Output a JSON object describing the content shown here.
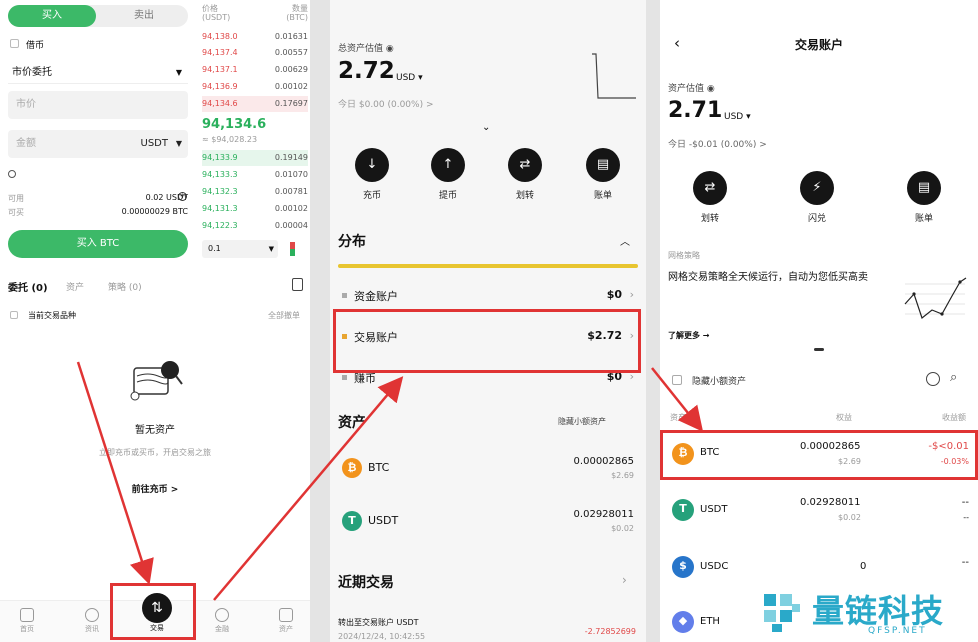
{
  "panel1": {
    "tab_buy": "买入",
    "tab_sell": "卖出",
    "leverage": "借币",
    "order_type": "市价委托",
    "price_placeholder": "市价",
    "amount_placeholder": "金额",
    "amount_unit": "USDT",
    "available_label": "可用",
    "available_value": "0.02 USDT",
    "buyable_label": "可买",
    "buyable_value": "0.00000029 BTC",
    "buy_button": "买入 BTC",
    "ob_header_price": "价格\n(USDT)",
    "ob_header_qty": "数量\n(BTC)",
    "asks": [
      {
        "price": "94,138.0",
        "qty": "0.01631"
      },
      {
        "price": "94,137.4",
        "qty": "0.00557"
      },
      {
        "price": "94,137.1",
        "qty": "0.00629"
      },
      {
        "price": "94,136.9",
        "qty": "0.00102"
      },
      {
        "price": "94,134.6",
        "qty": "0.17697"
      }
    ],
    "last_price": "94,134.6",
    "last_price_sub": "≈ $94,028.23",
    "bids": [
      {
        "price": "94,133.9",
        "qty": "0.19149"
      },
      {
        "price": "94,133.3",
        "qty": "0.01070"
      },
      {
        "price": "94,132.3",
        "qty": "0.00781"
      },
      {
        "price": "94,131.3",
        "qty": "0.00102"
      },
      {
        "price": "94,122.3",
        "qty": "0.00004"
      }
    ],
    "depth_value": "0.1",
    "orders_tab": "委托 (0)",
    "assets_tab": "资产",
    "strategy_tab": "策略 (0)",
    "current_pair_only": "当前交易品种",
    "cancel_all": "全部撤单",
    "empty_title": "暂无资产",
    "empty_desc": "立即充币或买币，开启交易之旅",
    "go_deposit": "前往充币 >",
    "bottom_tabs": [
      "首页",
      "资讯",
      "交易",
      "金融",
      "资产"
    ]
  },
  "panel2": {
    "total_label": "总资产估值",
    "total_value": "2.72",
    "total_unit": "USD ▾",
    "today_pnl": "今日 $0.00 (0.00%) >",
    "actions": [
      "充币",
      "提币",
      "划转",
      "账单"
    ],
    "distribution_title": "分布",
    "accounts": [
      {
        "name": "资金账户",
        "value": "$0"
      },
      {
        "name": "交易账户",
        "value": "$2.72"
      },
      {
        "name": "赚币",
        "value": "$0"
      }
    ],
    "assets_title": "资产",
    "hide_small": "隐藏小额资产",
    "assets": [
      {
        "symbol": "BTC",
        "amount": "0.00002865",
        "usd": "$2.69"
      },
      {
        "symbol": "USDT",
        "amount": "0.02928011",
        "usd": "$0.02"
      }
    ],
    "recent_title": "近期交易",
    "recent_item": "转出至交易账户 USDT",
    "recent_date": "2024/12/24, 10:42:55",
    "recent_amount": "-2.72852699"
  },
  "panel3": {
    "title": "交易账户",
    "valuation_label": "资产估值",
    "value": "2.71",
    "unit": "USD ▾",
    "today_pnl": "今日 -$0.01 (0.00%) >",
    "actions": [
      "划转",
      "闪兑",
      "账单"
    ],
    "grid_tag": "网格策略",
    "grid_text": "网格交易策略全天候运行，自动为您低买高卖",
    "learn_more": "了解更多 →",
    "hide_small": "隐藏小额资产",
    "col_asset": "资产",
    "col_equity": "权益",
    "col_pnl": "收益额",
    "rows": [
      {
        "symbol": "BTC",
        "amount": "0.00002865",
        "usd": "$2.69",
        "pnl": "-$<0.01",
        "pnl_pct": "-0.03%"
      },
      {
        "symbol": "USDT",
        "amount": "0.02928011",
        "usd": "$0.02",
        "pnl": "--",
        "pnl_pct": "--"
      },
      {
        "symbol": "USDC",
        "amount": "0",
        "usd": "",
        "pnl": "--",
        "pnl_pct": ""
      },
      {
        "symbol": "ETH",
        "amount": "",
        "usd": "",
        "pnl": "",
        "pnl_pct": ""
      }
    ]
  },
  "watermark": {
    "brand": "量链科技",
    "domain": "QFSP.NET"
  },
  "colors": {
    "green": "#3cb968",
    "red": "#e03434",
    "btc": "#f2931c",
    "usdt": "#26a17b",
    "usdc": "#2775ca",
    "eth": "#627eea",
    "watermark": "#2aa9c9"
  }
}
